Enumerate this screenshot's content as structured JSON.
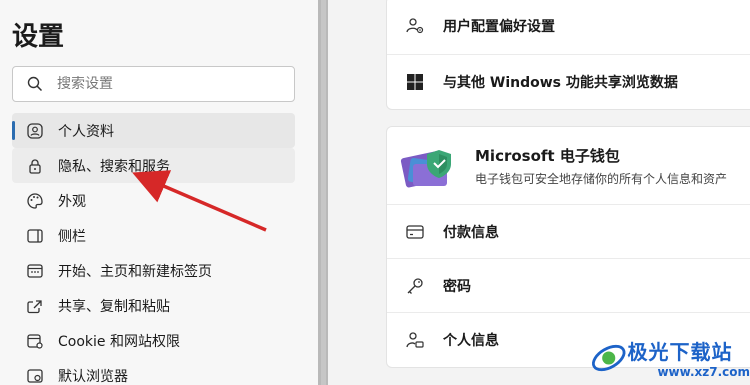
{
  "sidebar": {
    "title": "设置",
    "search_placeholder": "搜索设置",
    "items": [
      {
        "label": "个人资料",
        "icon": "profile-icon"
      },
      {
        "label": "隐私、搜索和服务",
        "icon": "lock-icon"
      },
      {
        "label": "外观",
        "icon": "palette-icon"
      },
      {
        "label": "侧栏",
        "icon": "sidebar-icon"
      },
      {
        "label": "开始、主页和新建标签页",
        "icon": "home-icon"
      },
      {
        "label": "共享、复制和粘贴",
        "icon": "share-icon"
      },
      {
        "label": "Cookie 和网站权限",
        "icon": "site-permissions-icon"
      },
      {
        "label": "默认浏览器",
        "icon": "browser-icon"
      }
    ]
  },
  "main": {
    "card1": {
      "rows": [
        {
          "label": "用户配置偏好设置",
          "icon": "user-settings-icon"
        },
        {
          "label": "与其他 Windows 功能共享浏览数据",
          "icon": "windows-icon"
        }
      ]
    },
    "wallet": {
      "title": "Microsoft 电子钱包",
      "description": "电子钱包可安全地存储你的所有个人信息和资产",
      "rows": [
        {
          "label": "付款信息",
          "icon": "card-icon"
        },
        {
          "label": "密码",
          "icon": "key-icon"
        },
        {
          "label": "个人信息",
          "icon": "person-card-icon"
        }
      ]
    }
  },
  "watermark": {
    "text": "极光下载站",
    "url": "www.xz7.com"
  },
  "colors": {
    "accent": "#2b6cb0",
    "arrow": "#d62828",
    "watermark": "#1d63c8"
  }
}
